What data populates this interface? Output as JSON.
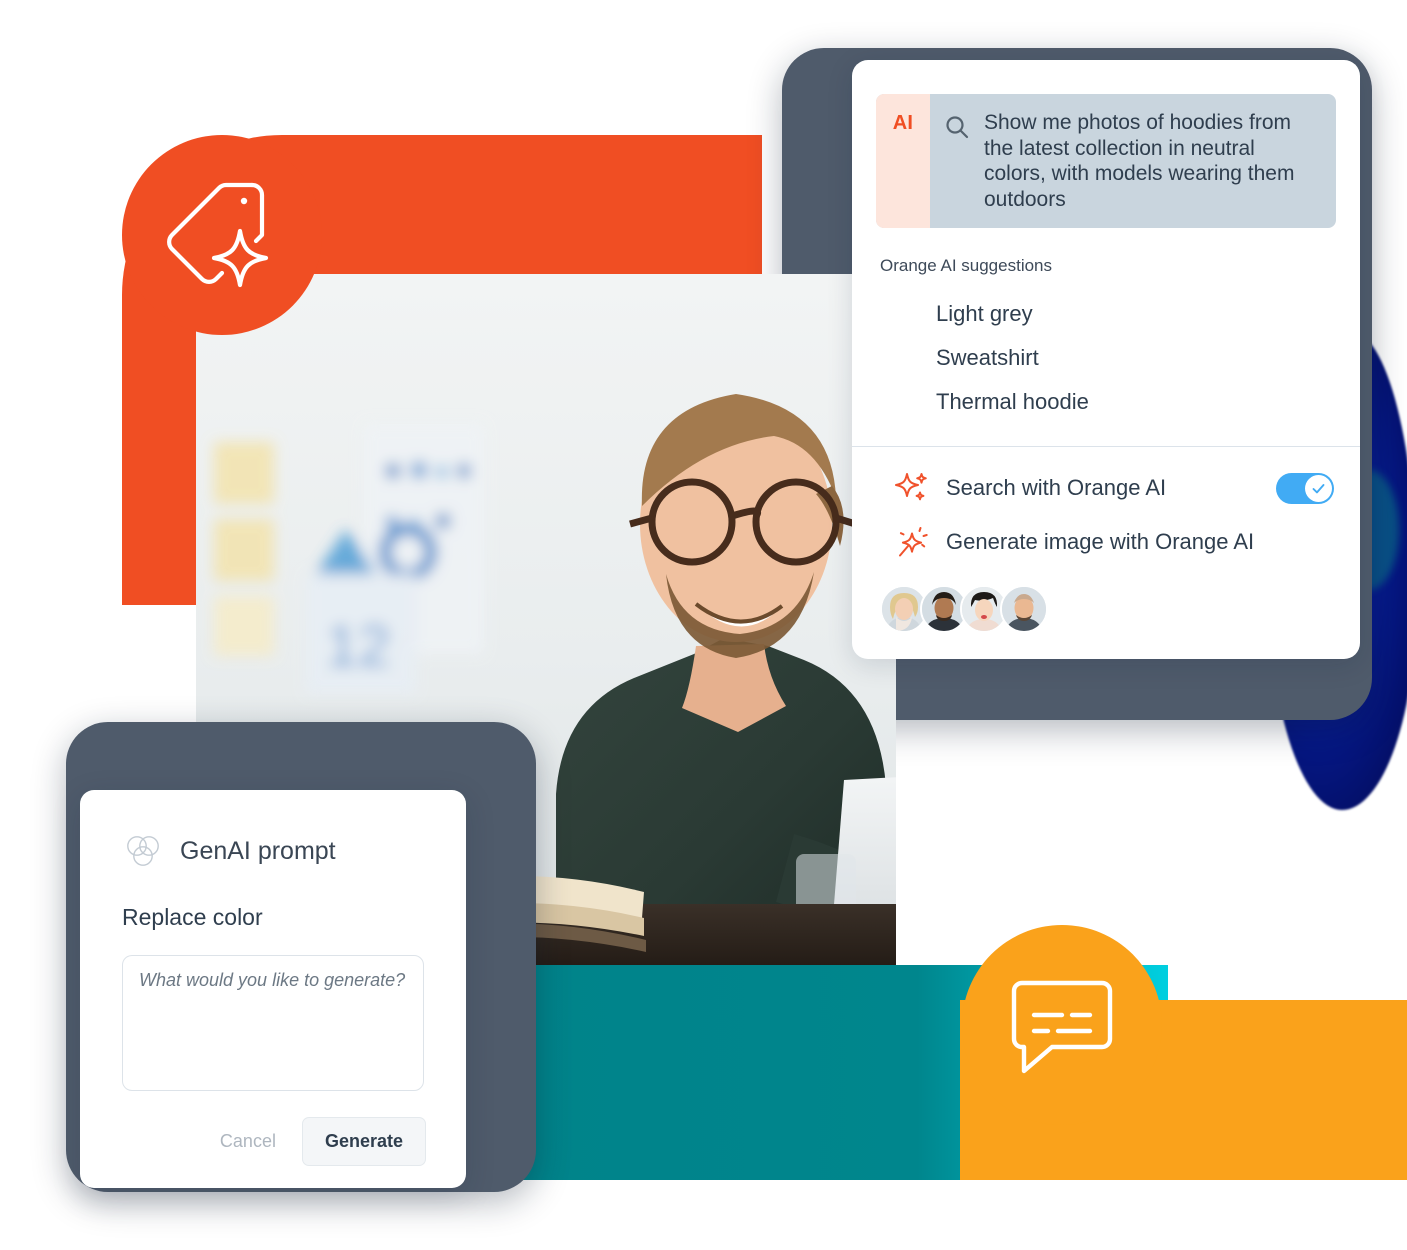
{
  "badges": {
    "tag_icon": "tag-sparkle-icon",
    "chat_icon": "chat-bubble-icon"
  },
  "colors": {
    "orange": "#F04E23",
    "amber": "#FAA21B",
    "teal": "#00838A",
    "cyan": "#00CFE0",
    "navy": "#061A8E",
    "device_frame": "#4F5B6B",
    "toggle_on": "#41ABF4",
    "ai_chip_bg": "#FDE5DC",
    "search_field_bg": "#C9D5DE",
    "text_primary": "#2F3E4E"
  },
  "search_panel": {
    "ai_chip_label": "AI",
    "search_icon": "magnifier-icon",
    "query_text": "Show me photos of hoodies from the latest collection in neutral colors, with models wearing them outdoors",
    "suggestions_label": "Orange AI suggestions",
    "suggestions": [
      {
        "label": "Light grey"
      },
      {
        "label": "Sweatshirt"
      },
      {
        "label": "Thermal hoodie"
      }
    ],
    "actions": [
      {
        "label": "Search with Orange AI",
        "icon": "sparkles-icon",
        "toggle": true,
        "toggle_on": true
      },
      {
        "label": "Generate image with Orange AI",
        "icon": "magic-wand-sparkle-icon",
        "toggle": false
      }
    ],
    "avatars": [
      {
        "name": "avatar-person-1"
      },
      {
        "name": "avatar-person-2"
      },
      {
        "name": "avatar-person-3"
      },
      {
        "name": "avatar-person-4"
      }
    ]
  },
  "genai_card": {
    "icon": "three-circles-venn-icon",
    "title": "GenAI prompt",
    "subtitle": "Replace color",
    "textarea_value": "",
    "textarea_placeholder": "What would you like to generate?",
    "cancel_label": "Cancel",
    "generate_label": "Generate"
  },
  "hero_photo": {
    "alt": "Smiling bearded man with glasses in a dark green shirt working at a laptop in a bright office"
  }
}
